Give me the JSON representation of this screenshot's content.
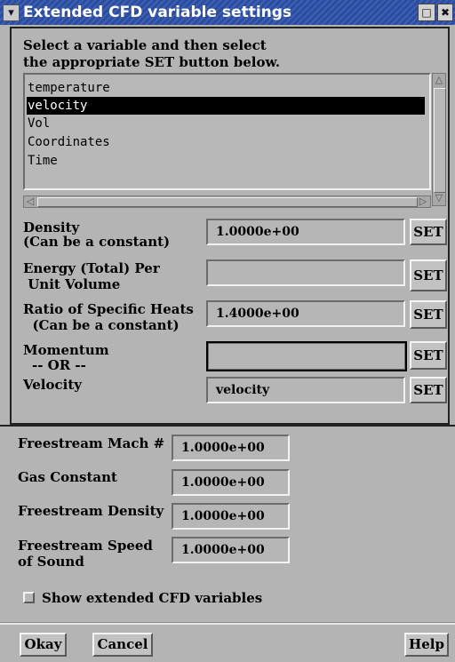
{
  "window": {
    "title": "Extended CFD variable settings",
    "menu_icon": "chevron-down-icon",
    "maximize_icon": "maximize-icon",
    "close_icon": "close-icon",
    "menu_glyph": "❯",
    "maximize_glyph": "□",
    "close_glyph": "✖"
  },
  "instructions": {
    "line1": "Select a variable and then select",
    "line2": "the appropriate SET button below."
  },
  "variables": {
    "items": [
      "temperature",
      "velocity",
      "Vol",
      "Coordinates",
      "Time"
    ],
    "selected": "velocity"
  },
  "settings": [
    {
      "label_line1": "Density",
      "label_line2": "(Can be a constant)",
      "value": "1.0000e+00",
      "button": "SET"
    },
    {
      "label_line1": "Energy (Total) Per",
      "label_line2": " Unit Volume",
      "value": "",
      "button": "SET"
    },
    {
      "label_line1": "Ratio of Specific Heats",
      "label_line2": "  (Can be a constant)",
      "value": "1.4000e+00",
      "button": "SET"
    },
    {
      "label_line1": "Momentum",
      "label_line2": "-- OR --",
      "value": "",
      "button": "SET"
    },
    {
      "label_line1": "Velocity",
      "value": "velocity",
      "button": "SET"
    }
  ],
  "freestream": [
    {
      "label_line1": "Freestream Mach #",
      "value": "1.0000e+00"
    },
    {
      "label_line1": "Gas Constant",
      "value": "1.0000e+00"
    },
    {
      "label_line1": "Freestream Density",
      "value": "1.0000e+00"
    },
    {
      "label_line1": "Freestream Speed",
      "label_line2": "of Sound",
      "value": "1.0000e+00"
    }
  ],
  "checkbox": {
    "label": "Show extended CFD variables",
    "checked": false
  },
  "buttons": {
    "okay": "Okay",
    "cancel": "Cancel",
    "help": "Help"
  }
}
